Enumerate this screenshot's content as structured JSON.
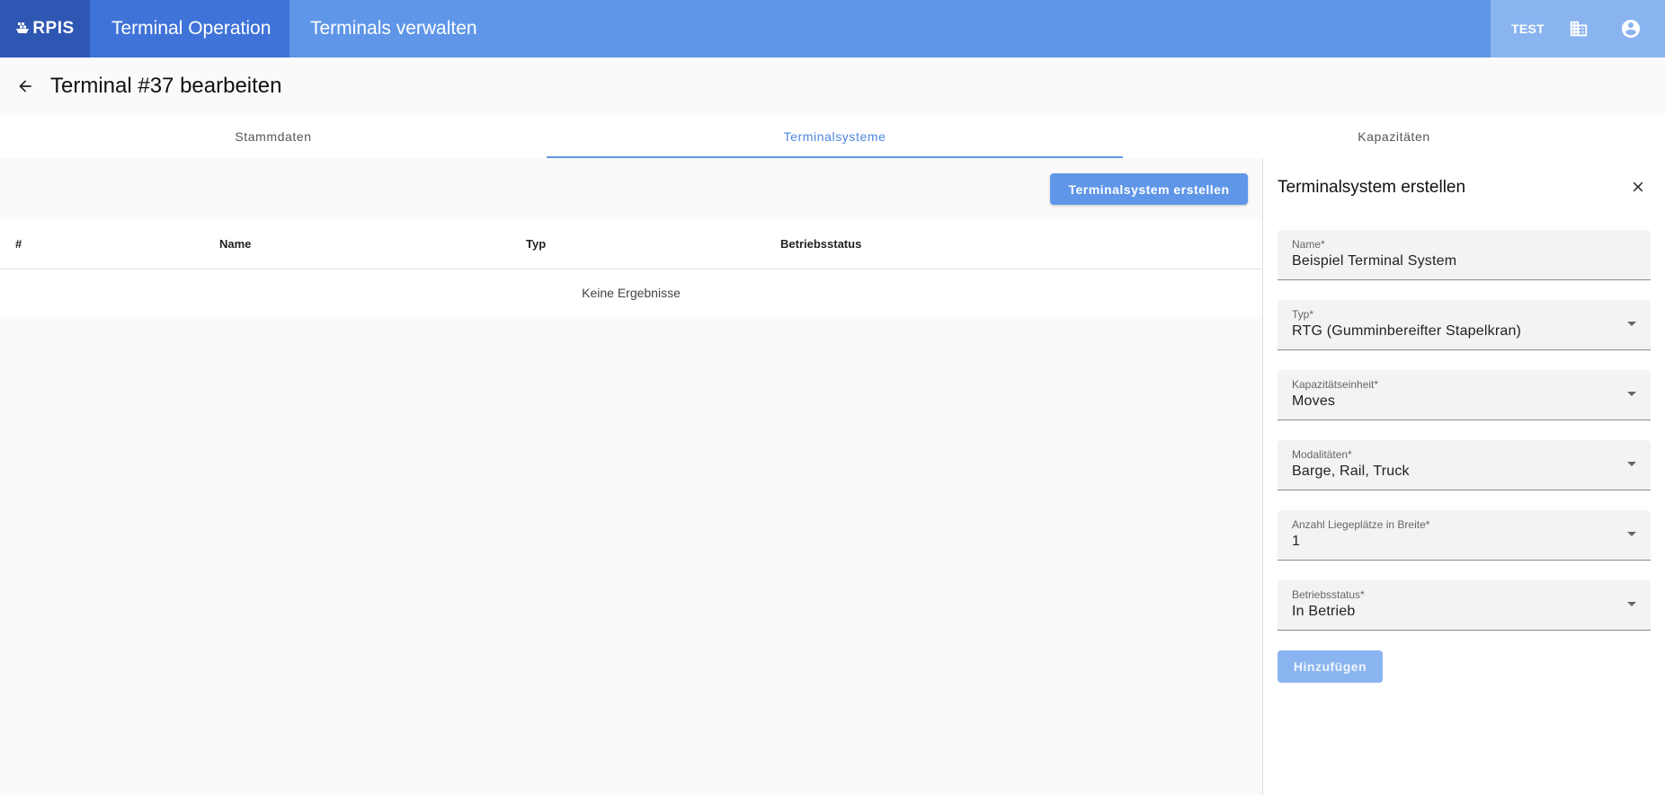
{
  "topbar": {
    "logo_text": "RPIS",
    "app_title": "Terminal Operation",
    "page_crumb": "Terminals verwalten",
    "env_label": "TEST"
  },
  "header": {
    "title": "Terminal #37 bearbeiten"
  },
  "tabs": [
    {
      "label": "Stammdaten"
    },
    {
      "label": "Terminalsysteme"
    },
    {
      "label": "Kapazitäten"
    }
  ],
  "main": {
    "create_button": "Terminalsystem erstellen",
    "table": {
      "columns": [
        "#",
        "Name",
        "Typ",
        "Betriebsstatus"
      ],
      "empty_text": "Keine Ergebnisse"
    }
  },
  "panel": {
    "title": "Terminalsystem erstellen",
    "fields": [
      {
        "label": "Name*",
        "value": "Beispiel Terminal System"
      },
      {
        "label": "Typ*",
        "value": "RTG (Gumminbereifter Stapelkran)"
      },
      {
        "label": "Kapazitätseinheit*",
        "value": "Moves"
      },
      {
        "label": "Modalitäten*",
        "value": "Barge, Rail, Truck"
      },
      {
        "label": "Anzahl Liegeplätze in Breite*",
        "value": "1"
      },
      {
        "label": "Betriebsstatus*",
        "value": "In Betrieb"
      }
    ],
    "submit_button": "Hinzufügen"
  },
  "colors": {
    "primary": "#5f96e8",
    "primary_dark": "#3f73d8",
    "logo_bg": "#2e57b3",
    "disabled_button": "#8ab4f0"
  }
}
